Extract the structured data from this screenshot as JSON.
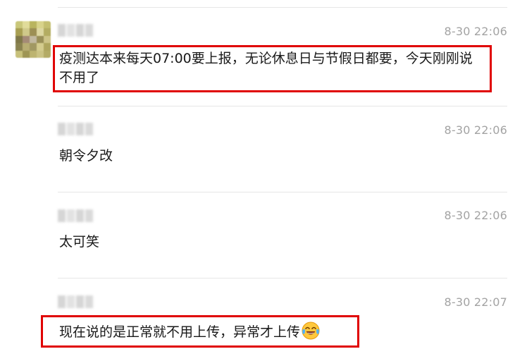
{
  "messages": [
    {
      "timestamp": "8-30 22:06",
      "text": "疫测达本来每天07:00要上报，无论休息日与节假日都要，今天刚刚说不用了"
    },
    {
      "timestamp": "8-30 22:06",
      "text": "朝令夕改"
    },
    {
      "timestamp": "8-30 22:06",
      "text": "太可笑"
    },
    {
      "timestamp": "8-30 22:07",
      "text": "现在说的是正常就不用上传，异常才上传",
      "emoji": "laughing-crying-emoji"
    }
  ],
  "colors": {
    "highlight": "#e00000",
    "timestamp": "#a3a3a3",
    "divider": "#e6e6e6",
    "message_text": "#191919"
  }
}
